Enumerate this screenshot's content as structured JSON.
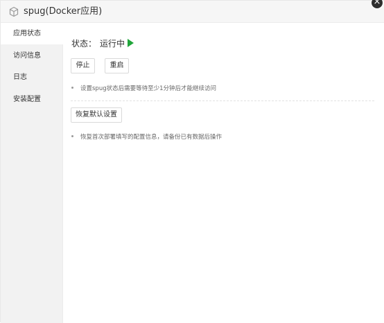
{
  "window": {
    "title": "spug(Docker应用)",
    "close_label": "×",
    "icon": "cube-icon"
  },
  "sidebar": {
    "items": [
      {
        "label": "应用状态"
      },
      {
        "label": "访问信息"
      },
      {
        "label": "日志"
      },
      {
        "label": "安装配置"
      }
    ]
  },
  "main": {
    "status_label": "状态：",
    "status_value": "运行中",
    "status_icon": "play-icon",
    "status_color": "#20a53a",
    "buttons": {
      "stop": "停止",
      "restart": "重启",
      "restore": "恢复默认设置"
    },
    "notes": {
      "status_note": "设置spug状态后需要等待至少1分钟后才能继续访问",
      "restore_note": "恢复首次部署填写的配置信息，请备份已有数据后操作"
    }
  }
}
